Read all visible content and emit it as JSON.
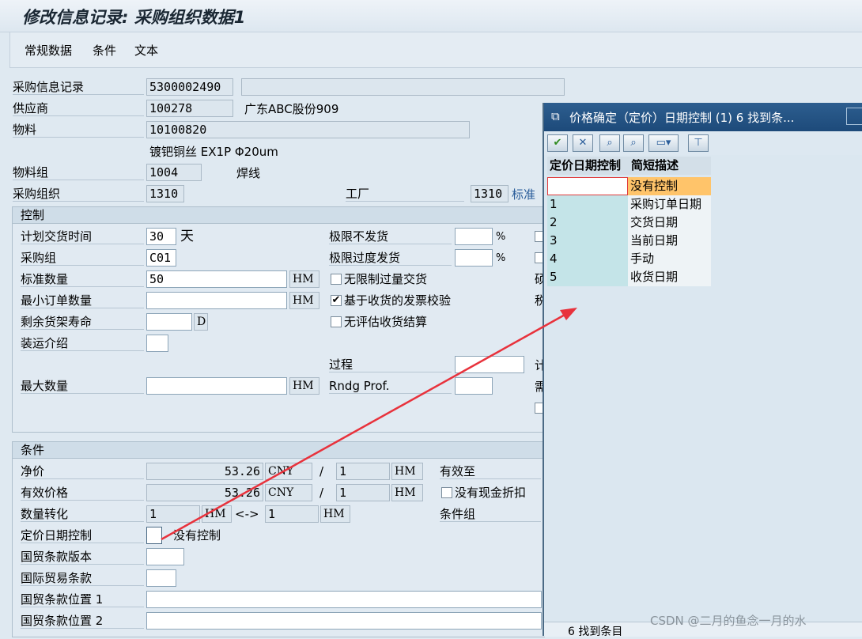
{
  "window_title": "修改信息记录: 采购组织数据1",
  "tabs": [
    "常规数据",
    "条件",
    "文本"
  ],
  "header": {
    "info_record_label": "采购信息记录",
    "info_record_value": "5300002490",
    "vendor_label": "供应商",
    "vendor_value": "100278",
    "vendor_name": "广东ABC股份909",
    "material_label": "物料",
    "material_value": "10100820",
    "material_desc": "镀钯铜丝 EX1P Φ20um",
    "material_group_label": "物料组",
    "material_group_value": "1004",
    "material_group_desc": "焊线",
    "purch_org_label": "采购组织",
    "purch_org_value": "1310",
    "plant_label": "工厂",
    "plant_value": "1310",
    "plant_extra": "标准"
  },
  "control": {
    "title": "控制",
    "planned_delivery_label": "计划交货时间",
    "planned_delivery_value": "30",
    "planned_delivery_unit": "天",
    "purch_group_label": "采购组",
    "purch_group_value": "C01",
    "std_qty_label": "标准数量",
    "std_qty_value": "50",
    "std_qty_unit": "HM",
    "min_qty_label": "最小订单数量",
    "min_qty_unit": "HM",
    "shelf_life_label": "剩余货架寿命",
    "shelf_life_unit": "D",
    "shipping_label": "装运介绍",
    "max_qty_label": "最大数量",
    "max_qty_unit": "HM",
    "underdelivery_label": "极限不发货",
    "underdelivery_unit": "%",
    "overdelivery_label": "极限过度发货",
    "overdelivery_unit": "%",
    "unlimited_label": "无限制过量交货",
    "unlimited_checked": false,
    "gr_iv_label": "基于收货的发票校验",
    "gr_iv_checked": true,
    "ers_label": "无评估收货结算",
    "ers_checked": false,
    "procedure_label": "过程",
    "rndg_label": "Rndg Prof.",
    "cut_1": "硕",
    "cut_2": "税",
    "cut_3": "计",
    "cut_4": "需"
  },
  "conditions": {
    "title": "条件",
    "net_price_label": "净价",
    "net_price_value": "53.26",
    "net_price_curr": "CNY",
    "net_per": "1",
    "net_unit": "HM",
    "eff_price_label": "有效价格",
    "eff_price_value": "53.26",
    "eff_price_curr": "CNY",
    "eff_per": "1",
    "eff_unit": "HM",
    "slash": "/",
    "valid_to_label": "有效至",
    "no_discount_label": "没有现金折扣",
    "qty_conv_label": "数量转化",
    "qty_conv_from": "1",
    "qty_conv_from_unit": "HM",
    "qty_conv_arrow": "<->",
    "qty_conv_to": "1",
    "qty_conv_to_unit": "HM",
    "cond_group_label": "条件组",
    "pricing_date_label": "定价日期控制",
    "pricing_date_desc": "没有控制",
    "incoterms_version_label": "国贸条款版本",
    "incoterms_label": "国际贸易条款",
    "incoterms_loc1_label": "国贸条款位置 1",
    "incoterms_loc2_label": "国贸条款位置 2"
  },
  "popup": {
    "title": "价格确定（定价）日期控制 (1)   6 找到条...",
    "col1": "定价日期控制",
    "col2": "简短描述",
    "rows": [
      {
        "key": "",
        "desc": "没有控制"
      },
      {
        "key": "1",
        "desc": "采购订单日期"
      },
      {
        "key": "2",
        "desc": "交货日期"
      },
      {
        "key": "3",
        "desc": "当前日期"
      },
      {
        "key": "4",
        "desc": "手动"
      },
      {
        "key": "5",
        "desc": "收货日期"
      }
    ],
    "status": "6 找到条目"
  },
  "watermark": "CSDN @二月的鱼念一月的水",
  "colors": {
    "popup_title": "#1d4a7a",
    "highlight_row": "#ffc46a",
    "key_col": "#c4e4e8",
    "arrow": "#e8323c"
  }
}
